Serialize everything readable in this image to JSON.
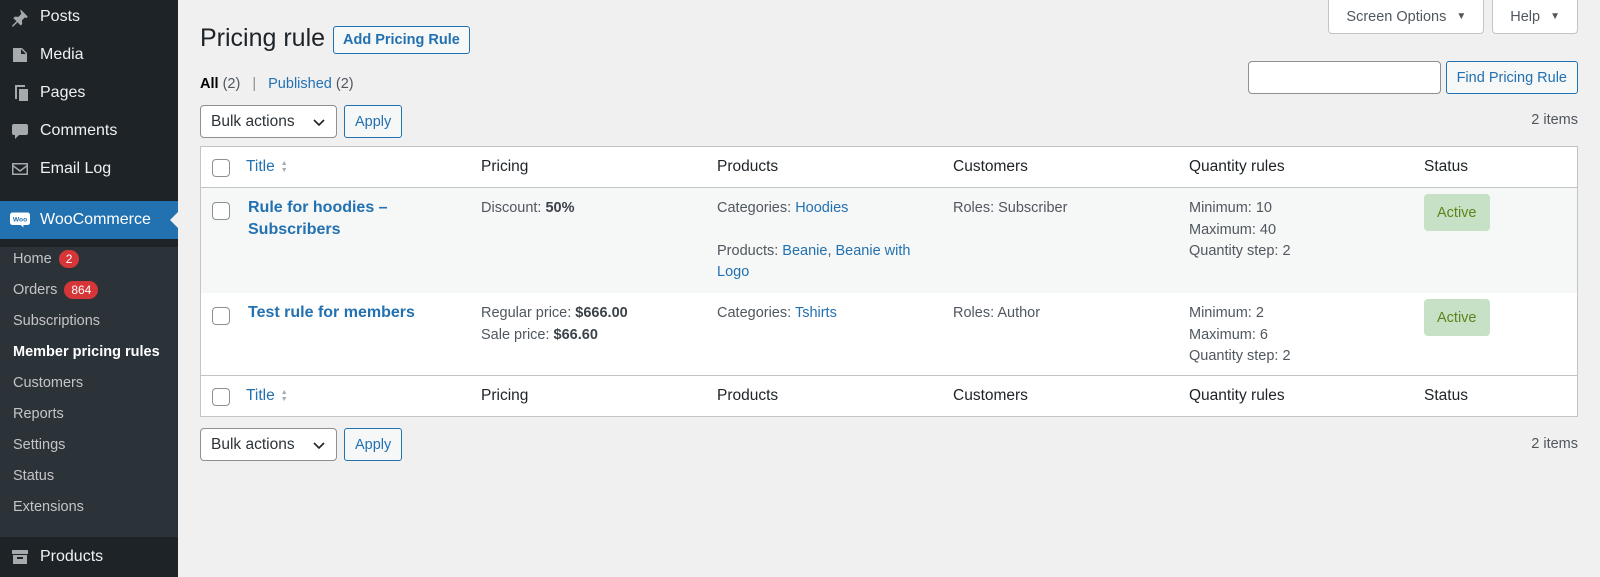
{
  "sidebar": {
    "top_items": [
      {
        "label": "Posts",
        "icon": "pin-icon"
      },
      {
        "label": "Media",
        "icon": "media-icon"
      },
      {
        "label": "Pages",
        "icon": "pages-icon"
      },
      {
        "label": "Comments",
        "icon": "comments-icon"
      },
      {
        "label": "Email Log",
        "icon": "email-icon"
      }
    ],
    "woocommerce": {
      "label": "WooCommerce",
      "icon_text": "Woo"
    },
    "submenu": [
      {
        "label": "Home",
        "badge": "2"
      },
      {
        "label": "Orders",
        "badge": "864"
      },
      {
        "label": "Subscriptions"
      },
      {
        "label": "Member pricing rules",
        "current": true
      },
      {
        "label": "Customers"
      },
      {
        "label": "Reports"
      },
      {
        "label": "Settings"
      },
      {
        "label": "Status"
      },
      {
        "label": "Extensions"
      }
    ],
    "bottom_item": {
      "label": "Products",
      "icon": "archive-icon"
    }
  },
  "screen_meta": {
    "screen_options": "Screen Options",
    "help": "Help",
    "caret": "▼"
  },
  "page": {
    "title": "Pricing rule",
    "add_new": "Add Pricing Rule"
  },
  "views": {
    "all_label": "All",
    "all_count": "(2)",
    "separator": "|",
    "published_label": "Published",
    "published_count": "(2)"
  },
  "search": {
    "value": "",
    "button": "Find Pricing Rule"
  },
  "tablenav": {
    "bulk_label": "Bulk actions",
    "apply": "Apply",
    "items": "2 items"
  },
  "columns": {
    "title": "Title",
    "pricing": "Pricing",
    "products": "Products",
    "customers": "Customers",
    "quantity": "Quantity rules",
    "status": "Status"
  },
  "rows": [
    {
      "title_line1": "Rule for hoodies –",
      "title_line2": "Subscribers",
      "pricing": [
        {
          "label": "Discount:",
          "value": "50%"
        }
      ],
      "categories_label": "Categories:",
      "categories": "Hoodies",
      "products_label": "Products:",
      "products_1": "Beanie",
      "products_sep": ",",
      "products_2a": "Beanie with",
      "products_2b": "Logo",
      "customers": "Roles: Subscriber",
      "quantity": [
        "Minimum: 10",
        "Maximum: 40",
        "Quantity step: 2"
      ],
      "status": "Active"
    },
    {
      "title_line1": "Test rule for members",
      "pricing": [
        {
          "label": "Regular price:",
          "value": "$666.00"
        },
        {
          "label": "Sale price:",
          "value": "$66.60"
        }
      ],
      "categories_label": "Categories:",
      "categories": "Tshirts",
      "customers": "Roles: Author",
      "quantity": [
        "Minimum: 2",
        "Maximum: 6",
        "Quantity step: 2"
      ],
      "status": "Active"
    }
  ],
  "colors": {
    "sidebar_bg": "#1d2327",
    "accent": "#2271b1",
    "badge": "#d63638",
    "status_bg": "#c6e1c6",
    "status_text": "#5b841b"
  }
}
